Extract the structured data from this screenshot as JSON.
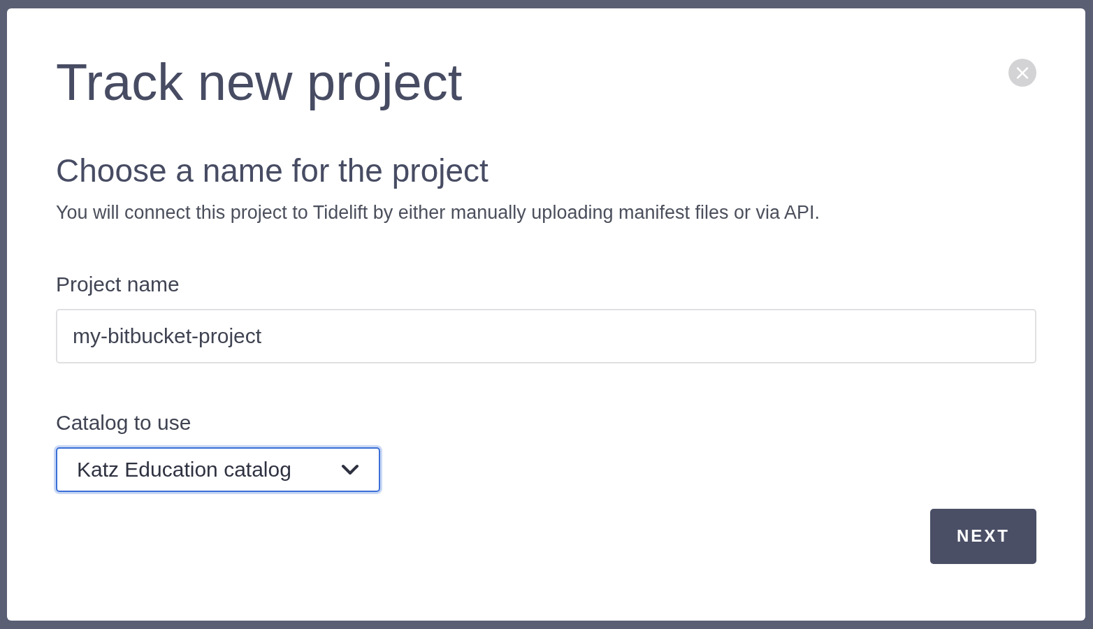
{
  "dialog": {
    "title": "Track new project",
    "close_icon": "×"
  },
  "section": {
    "heading": "Choose a name for the project",
    "description": "You will connect this project to Tidelift by either manually uploading manifest files or via API."
  },
  "fields": [
    {
      "kind": "text",
      "label": "Project name",
      "value": "my-bitbucket-project"
    },
    {
      "kind": "select",
      "label": "Catalog to use",
      "value": "Katz Education catalog",
      "focused": true
    }
  ],
  "buttons": [
    {
      "label": "NEXT"
    }
  ]
}
